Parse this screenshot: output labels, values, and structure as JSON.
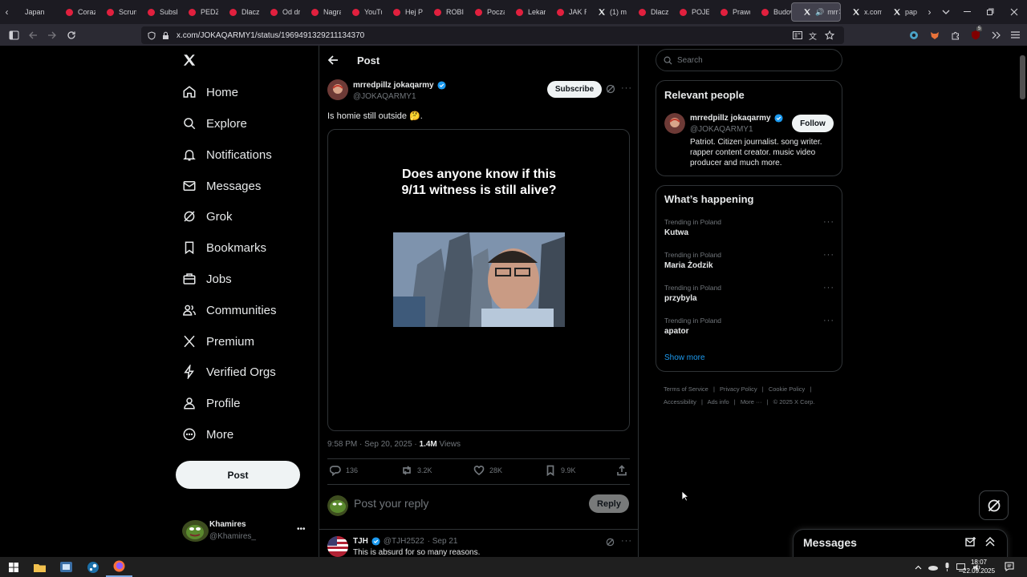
{
  "browser": {
    "tabs": [
      {
        "label": "Japan",
        "icon": "none"
      },
      {
        "label": "Coraz",
        "icon": "youtube"
      },
      {
        "label": "Scrum",
        "icon": "youtube"
      },
      {
        "label": "Subsk",
        "icon": "youtube"
      },
      {
        "label": "PEDZI",
        "icon": "youtube"
      },
      {
        "label": "Dlacz",
        "icon": "youtube"
      },
      {
        "label": "Od dr",
        "icon": "youtube"
      },
      {
        "label": "Nagra",
        "icon": "youtube"
      },
      {
        "label": "YouTu",
        "icon": "youtube"
      },
      {
        "label": "Hej P",
        "icon": "youtube"
      },
      {
        "label": "ROBIN",
        "icon": "youtube"
      },
      {
        "label": "Pocza",
        "icon": "youtube"
      },
      {
        "label": "Lekar",
        "icon": "youtube"
      },
      {
        "label": "JAK R",
        "icon": "youtube"
      },
      {
        "label": "(1) m",
        "icon": "x"
      },
      {
        "label": "Dlacz",
        "icon": "youtube"
      },
      {
        "label": "POJEC",
        "icon": "youtube"
      },
      {
        "label": "Prawd",
        "icon": "youtube"
      },
      {
        "label": "Budow",
        "icon": "youtube"
      },
      {
        "label": "mrr",
        "icon": "x",
        "active": true
      },
      {
        "label": "x.com",
        "icon": "x"
      },
      {
        "label": "pap",
        "icon": "x"
      }
    ],
    "url": "x.com/JOKAQARMY1/status/1969491329211134370",
    "extension_badge": "5"
  },
  "sidebar": {
    "items": [
      {
        "label": "Home",
        "icon": "home-icon"
      },
      {
        "label": "Explore",
        "icon": "search-icon"
      },
      {
        "label": "Notifications",
        "icon": "bell-icon"
      },
      {
        "label": "Messages",
        "icon": "mail-icon"
      },
      {
        "label": "Grok",
        "icon": "grok-icon"
      },
      {
        "label": "Bookmarks",
        "icon": "bookmark-icon"
      },
      {
        "label": "Jobs",
        "icon": "briefcase-icon"
      },
      {
        "label": "Communities",
        "icon": "people-icon"
      },
      {
        "label": "Premium",
        "icon": "x-logo-icon"
      },
      {
        "label": "Verified Orgs",
        "icon": "lightning-icon"
      },
      {
        "label": "Profile",
        "icon": "person-icon"
      },
      {
        "label": "More",
        "icon": "more-circle-icon"
      }
    ],
    "post_label": "Post",
    "account": {
      "name": "Khamires",
      "handle": "@Khamires_"
    }
  },
  "header": {
    "title": "Post"
  },
  "post": {
    "author_name": "mrredpillz jokaqarmy",
    "author_handle": "@JOKAQARMY1",
    "subscribe_label": "Subscribe",
    "text": "Is homie still outside 🤔.",
    "media_caption": "Does anyone know if this 9/11 witness is still alive?",
    "timestamp": "9:58 PM · Sep 20, 2025 · ",
    "views_count": "1.4M",
    "views_label": " Views",
    "stats": {
      "replies": "136",
      "reposts": "3.2K",
      "likes": "28K",
      "bookmarks": "9.9K"
    },
    "reply_placeholder": "Post your reply",
    "reply_button": "Reply"
  },
  "reply_preview": {
    "name": "TJH",
    "handle": "@TJH2522",
    "date": "· Sep 21",
    "text": "This is absurd for so many reasons."
  },
  "search": {
    "placeholder": "Search"
  },
  "relevant_people": {
    "title": "Relevant people",
    "name": "mrredpillz jokaqarmy",
    "handle": "@JOKAQARMY1",
    "follow_label": "Follow",
    "bio": "Patriot. Citizen journalist. song writer. rapper content creator. music video producer and much more."
  },
  "happening": {
    "title": "What’s happening",
    "trends": [
      {
        "meta": "Trending in Poland",
        "name": "Kutwa"
      },
      {
        "meta": "Trending in Poland",
        "name": "Maria Żodzik"
      },
      {
        "meta": "Trending in Poland",
        "name": "przybyla"
      },
      {
        "meta": "Trending in Poland",
        "name": "apator"
      }
    ],
    "show_more": "Show more"
  },
  "footer_links": {
    "terms": "Terms of Service",
    "privacy": "Privacy Policy",
    "cookie": "Cookie Policy",
    "accessibility": "Accessibility",
    "ads": "Ads info",
    "more": "More ···",
    "copyright": "© 2025 X Corp."
  },
  "messages_drawer": {
    "title": "Messages"
  },
  "taskbar": {
    "time": "18:07",
    "date": "22.09.2025"
  },
  "colors": {
    "verified": "#1d9bf0",
    "youtube": "#e1203e",
    "background": "#000000",
    "border": "#2f3336"
  }
}
